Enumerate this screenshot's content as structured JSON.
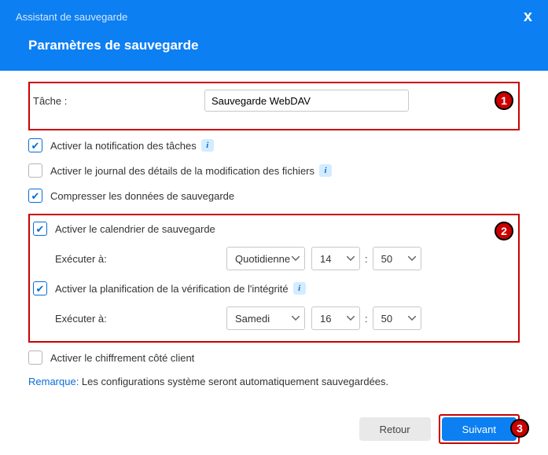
{
  "header": {
    "wizard_title": "Assistant de sauvegarde",
    "page_title": "Paramètres de sauvegarde"
  },
  "task": {
    "label": "Tâche :",
    "value": "Sauvegarde WebDAV"
  },
  "options": {
    "enable_task_notification": "Activer la notification des tâches",
    "enable_file_change_log": "Activer le journal des détails de la modification des fichiers",
    "compress_backup_data": "Compresser les données de sauvegarde",
    "enable_backup_schedule": "Activer le calendrier de sauvegarde",
    "enable_integrity_schedule": "Activer la planification de la vérification de l'intégrité",
    "enable_client_encryption": "Activer le chiffrement côté client"
  },
  "schedule": {
    "run_at_label": "Exécuter à:",
    "backup": {
      "frequency": "Quotidienne",
      "hour": "14",
      "minute": "50"
    },
    "integrity": {
      "frequency": "Samedi",
      "hour": "16",
      "minute": "50"
    }
  },
  "remark": {
    "label": "Remarque:",
    "text": " Les configurations système seront automatiquement sauvegardées."
  },
  "footer": {
    "back": "Retour",
    "next": "Suivant"
  },
  "annotations": {
    "one": "1",
    "two": "2",
    "three": "3"
  }
}
